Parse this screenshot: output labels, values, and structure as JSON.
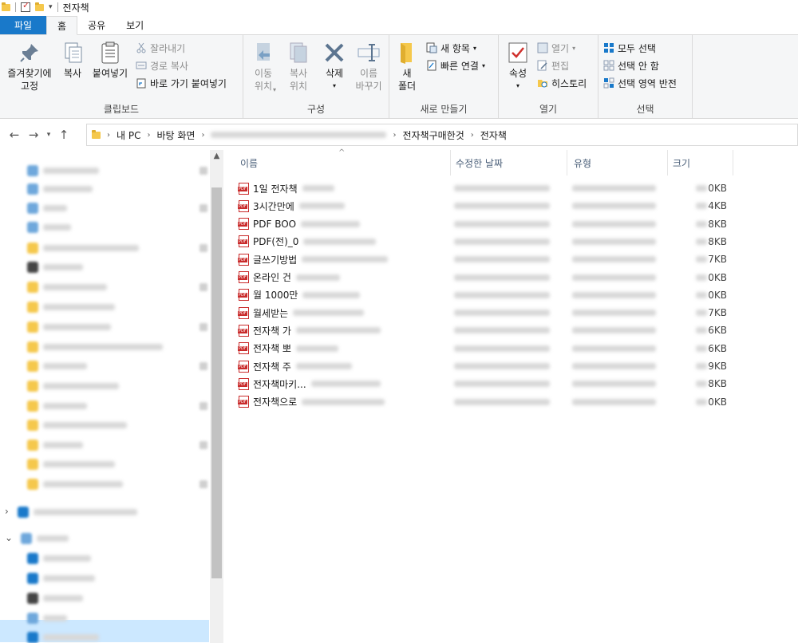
{
  "window": {
    "title": "전자책"
  },
  "ribbon_tabs": [
    {
      "label": "파일"
    },
    {
      "label": "홈"
    },
    {
      "label": "공유"
    },
    {
      "label": "보기"
    }
  ],
  "ribbon": {
    "clipboard": {
      "label": "클립보드",
      "pin": "즐겨찾기에\n고정",
      "copy": "복사",
      "paste": "붙여넣기",
      "cut": "잘라내기",
      "copy_path": "경로 복사",
      "paste_shortcut": "바로 가기 붙여넣기"
    },
    "organize": {
      "label": "구성",
      "move_to": "이동\n위치",
      "copy_to": "복사\n위치",
      "delete": "삭제",
      "rename": "이름\n바꾸기"
    },
    "new": {
      "label": "새로 만들기",
      "new_folder": "새\n폴더",
      "new_item": "새 항목",
      "easy_access": "빠른 연결"
    },
    "open": {
      "label": "열기",
      "properties": "속성",
      "open": "열기",
      "edit": "편집",
      "history": "히스토리"
    },
    "select": {
      "label": "선택",
      "select_all": "모두 선택",
      "select_none": "선택 안 함",
      "invert": "선택 영역 반전"
    }
  },
  "address": {
    "crumbs": [
      "내 PC",
      "바탕 화면",
      "전자책구매한것",
      "전자책"
    ]
  },
  "columns": {
    "name": "이름",
    "date": "수정한 날짜",
    "type": "유형",
    "size": "크기"
  },
  "files": [
    {
      "name": "1일 전자책",
      "size_suffix": "0KB"
    },
    {
      "name": "3시간만에",
      "size_suffix": "4KB"
    },
    {
      "name": "PDF BOO",
      "size_suffix": "8KB"
    },
    {
      "name": "PDF(전)_0",
      "size_suffix": "8KB"
    },
    {
      "name": "글쓰기방법",
      "size_suffix": "7KB"
    },
    {
      "name": "온라인 건",
      "size_suffix": "0KB"
    },
    {
      "name": "월 1000만",
      "size_suffix": "0KB"
    },
    {
      "name": "월세받는",
      "size_suffix": "7KB"
    },
    {
      "name": "전자책 가",
      "size_suffix": "6KB"
    },
    {
      "name": "전자책 뽀",
      "size_suffix": "6KB"
    },
    {
      "name": "전자책 주",
      "size_suffix": "9KB"
    },
    {
      "name": "전자책마키...",
      "size_suffix": "8KB"
    },
    {
      "name": "전자책으로",
      "size_suffix": "0KB"
    }
  ],
  "colors": {
    "file_tab": "#1979ca",
    "selection": "#cce8ff",
    "pdf_red": "#c92b2b",
    "folder": "#f5c84c"
  },
  "icons": {
    "file": "pdf-icon",
    "folder": "folder-icon"
  }
}
